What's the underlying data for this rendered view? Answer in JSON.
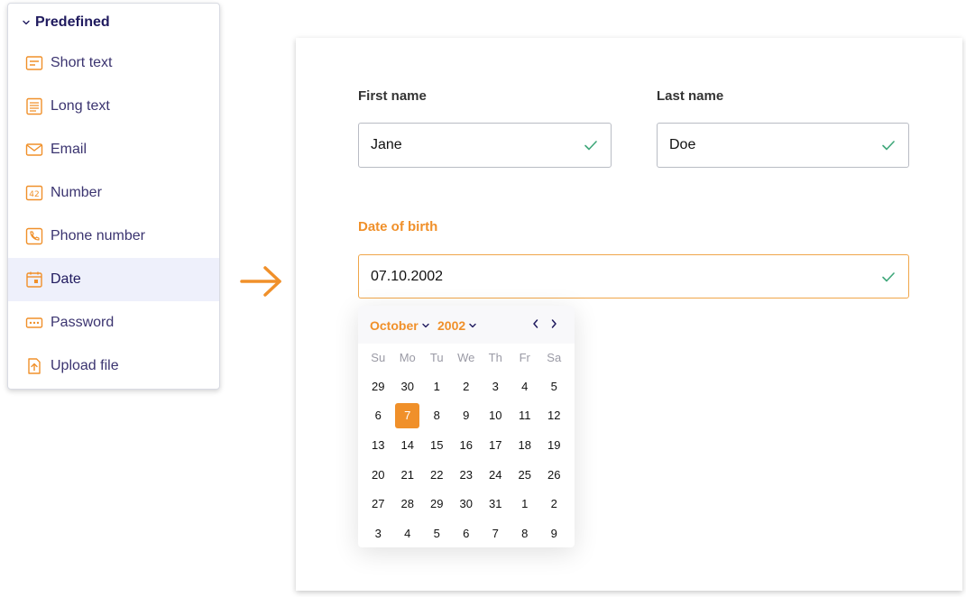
{
  "sidebar": {
    "group_label": "Predefined",
    "items": [
      {
        "label": "Short text",
        "icon": "short-text-icon"
      },
      {
        "label": "Long text",
        "icon": "long-text-icon"
      },
      {
        "label": "Email",
        "icon": "email-icon"
      },
      {
        "label": "Number",
        "icon": "number-icon"
      },
      {
        "label": "Phone number",
        "icon": "phone-icon"
      },
      {
        "label": "Date",
        "icon": "calendar-icon",
        "active": true
      },
      {
        "label": "Password",
        "icon": "password-icon"
      },
      {
        "label": "Upload file",
        "icon": "upload-icon"
      }
    ]
  },
  "form": {
    "first_name_label": "First name",
    "first_name_value": "Jane",
    "last_name_label": "Last name",
    "last_name_value": "Doe",
    "dob_label": "Date of birth",
    "dob_value": "07.10.2002"
  },
  "calendar": {
    "month": "October",
    "year": "2002",
    "weekdays": [
      "Su",
      "Mo",
      "Tu",
      "We",
      "Th",
      "Fr",
      "Sa"
    ],
    "weeks": [
      [
        "29",
        "30",
        "1",
        "2",
        "3",
        "4",
        "5"
      ],
      [
        "6",
        "7",
        "8",
        "9",
        "10",
        "11",
        "12"
      ],
      [
        "13",
        "14",
        "15",
        "16",
        "17",
        "18",
        "19"
      ],
      [
        "20",
        "21",
        "22",
        "23",
        "24",
        "25",
        "26"
      ],
      [
        "27",
        "28",
        "29",
        "30",
        "31",
        "1",
        "2"
      ],
      [
        "3",
        "4",
        "5",
        "6",
        "7",
        "8",
        "9"
      ]
    ],
    "selected_day": "7"
  },
  "colors": {
    "accent": "#f0902a",
    "nav_text": "#3b3470",
    "active_bg": "#eef0fb",
    "check": "#3fa77a"
  }
}
